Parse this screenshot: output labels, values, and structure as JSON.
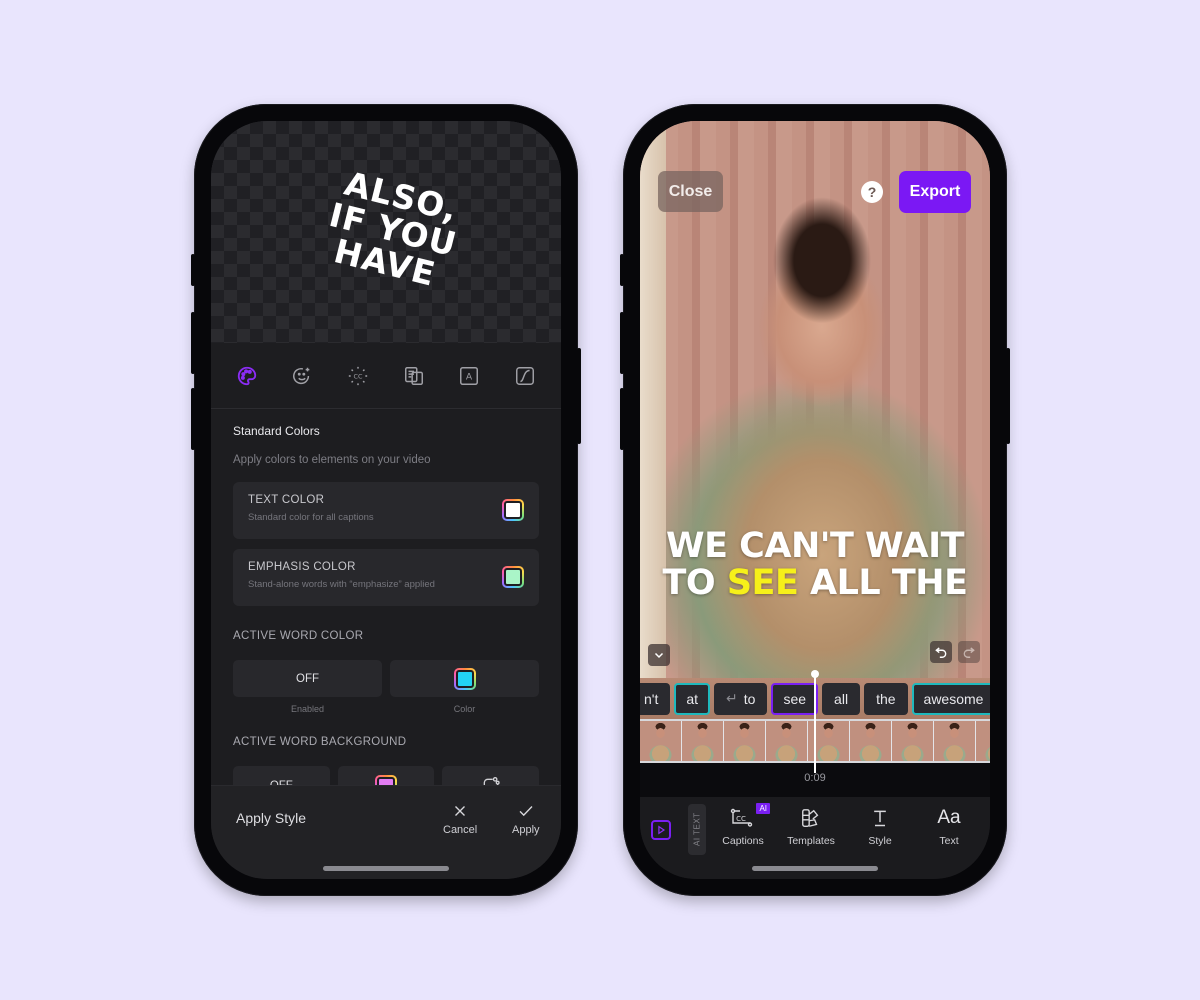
{
  "left_phone": {
    "preview_caption": [
      "ALSO,",
      "IF YOU HAVE"
    ],
    "tool_tabs": [
      {
        "name": "palette",
        "active": true
      },
      {
        "name": "emoji-sparkle",
        "active": false
      },
      {
        "name": "ai-captions",
        "active": false
      },
      {
        "name": "translate",
        "active": false
      },
      {
        "name": "font",
        "active": false
      },
      {
        "name": "animation-curve",
        "active": false
      }
    ],
    "panel": {
      "title": "Standard Colors",
      "subtitle": "Apply colors to elements on your video",
      "text_color": {
        "label": "TEXT COLOR",
        "desc": "Standard color for all captions",
        "color": "#ffffff"
      },
      "emphasis_color": {
        "label": "EMPHASIS COLOR",
        "desc": "Stand-alone words with “emphasize” applied",
        "color": "#aaf5c8"
      },
      "active_word_color": {
        "label": "ACTIVE WORD COLOR",
        "toggle_value": "OFF",
        "toggle_caption": "Enabled",
        "color": "#22d3f5",
        "color_caption": "Color"
      },
      "active_word_background": {
        "label": "ACTIVE WORD BACKGROUND",
        "toggle_value": "OFF",
        "color": "#e27cf2"
      }
    },
    "apply_bar": {
      "title": "Apply Style",
      "cancel_label": "Cancel",
      "apply_label": "Apply"
    }
  },
  "right_phone": {
    "close_label": "Close",
    "help_label": "?",
    "export_label": "Export",
    "caption_line1": "WE CAN'T WAIT",
    "caption_line2_pre": "TO ",
    "caption_line2_highlight": "SEE",
    "caption_line2_post": " ALL THE",
    "highlight_color": "#f6f01a",
    "accent_color": "#7b18f4",
    "words": [
      {
        "text": "n't",
        "style": "cut"
      },
      {
        "text": "at",
        "style": "teal"
      },
      {
        "text": "to",
        "style": "newline"
      },
      {
        "text": "see",
        "style": "purple"
      },
      {
        "text": "all",
        "style": ""
      },
      {
        "text": "the",
        "style": ""
      },
      {
        "text": "awesome",
        "style": "teal"
      }
    ],
    "timecode": "0:09",
    "ai_text_label": "AI TEXT",
    "nav": {
      "captions": "Captions",
      "ai_badge": "AI",
      "templates": "Templates",
      "style": "Style",
      "text": "Text",
      "text_icon": "Aa"
    }
  }
}
